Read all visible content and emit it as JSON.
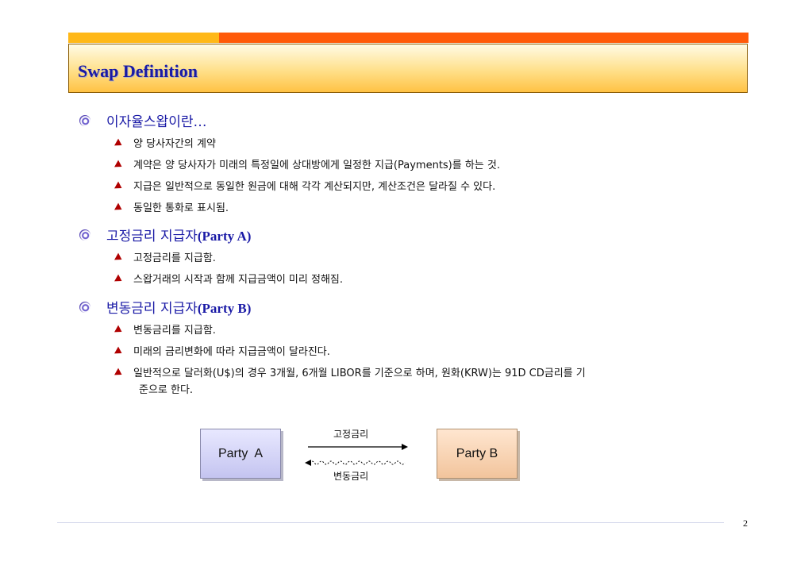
{
  "header": {
    "title": "Swap Definition"
  },
  "sections": [
    {
      "title": "이자율스왑이란…",
      "bullets": [
        "양 당사자간의 계약",
        "계약은 양 당사자가 미래의 특정일에 상대방에게 일정한 지급(Payments)를 하는 것.",
        "지급은 일반적으로 동일한 원금에 대해 각각 계산되지만, 계산조건은 달라질 수 있다.",
        "동일한 통화로 표시됨."
      ]
    },
    {
      "title_ko": "고정금리 지급자",
      "title_en": "(Party A)",
      "bullets": [
        "고정금리를 지급함.",
        "스왑거래의 시작과 함께 지급금액이 미리 정해짐."
      ]
    },
    {
      "title_ko": "변동금리 지급자",
      "title_en": "(Party B)",
      "bullets": [
        "변동금리를 지급함.",
        "미래의 금리변화에 따라 지급금액이 달라진다.",
        "일반적으로 달러화(U$)의 경우 3개월, 6개월 LIBOR를 기준으로 하며, 원화(KRW)는 91D CD금리를 기",
        "준으로 한다."
      ]
    }
  ],
  "diagram": {
    "party_a": "Party  A",
    "party_b": "Party B",
    "fixed_label": "고정금리",
    "floating_label": "변동금리"
  },
  "footer": {
    "page_number": "2"
  },
  "colors": {
    "title": "#1a1aa6",
    "bar_left": "#ffb818",
    "bar_right": "#ff5a0a",
    "bullet_arrow": "#b00000"
  }
}
